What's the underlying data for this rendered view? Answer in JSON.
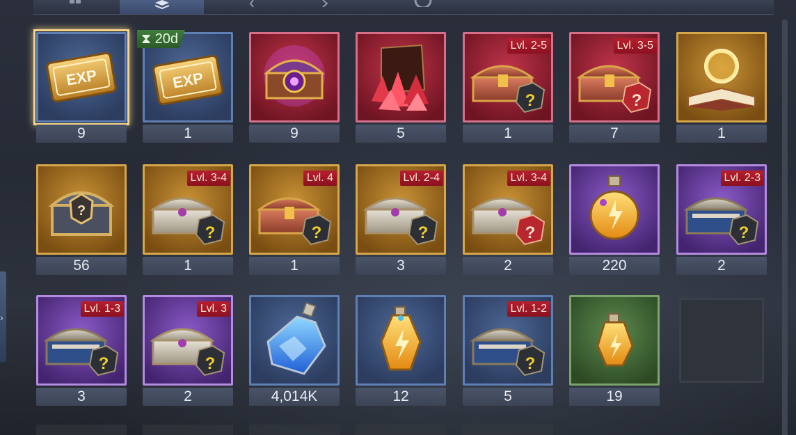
{
  "inventory": {
    "timer": "20d",
    "rows": [
      [
        {
          "icon": "exp-ticket-icon",
          "rarity": "blue",
          "count": "9",
          "selected": true
        },
        {
          "icon": "exp-ticket-icon",
          "rarity": "blue",
          "count": "1",
          "timer": true
        },
        {
          "icon": "magic-chest-icon",
          "rarity": "red",
          "count": "9"
        },
        {
          "icon": "red-crystal-icon",
          "rarity": "red",
          "count": "5"
        },
        {
          "icon": "red-chest-icon",
          "rarity": "red",
          "count": "1",
          "level": "Lvl. 2-5"
        },
        {
          "icon": "red-chest-icon",
          "rarity": "red",
          "count": "7",
          "level": "Lvl. 3-5"
        },
        {
          "icon": "spell-book-icon",
          "rarity": "gold",
          "count": "1"
        }
      ],
      [
        {
          "icon": "mystery-chest-icon",
          "rarity": "gold",
          "count": "56"
        },
        {
          "icon": "silver-chest-icon",
          "rarity": "gold",
          "count": "1",
          "level": "Lvl. 3-4"
        },
        {
          "icon": "red-chest-icon",
          "rarity": "gold",
          "count": "1",
          "level": "Lvl. 4"
        },
        {
          "icon": "silver-chest-icon",
          "rarity": "gold",
          "count": "3",
          "level": "Lvl. 2-4"
        },
        {
          "icon": "silver-chest-icon",
          "rarity": "gold",
          "count": "2",
          "level": "Lvl. 3-4"
        },
        {
          "icon": "gold-potion-icon",
          "rarity": "purple",
          "count": "220"
        },
        {
          "icon": "blue-chest-icon",
          "rarity": "purple",
          "count": "2",
          "level": "Lvl. 2-3"
        }
      ],
      [
        {
          "icon": "blue-chest-icon",
          "rarity": "purple",
          "count": "3",
          "level": "Lvl. 1-3"
        },
        {
          "icon": "silver-chest-icon",
          "rarity": "purple",
          "count": "2",
          "level": "Lvl. 3"
        },
        {
          "icon": "blue-potion-icon",
          "rarity": "blue",
          "count": "4,014K"
        },
        {
          "icon": "gold-potion-icon",
          "rarity": "blue",
          "count": "12"
        },
        {
          "icon": "blue-chest-icon",
          "rarity": "blue",
          "count": "5",
          "level": "Lvl. 1-2"
        },
        {
          "icon": "gold-potion-icon",
          "rarity": "green",
          "count": "19"
        },
        {
          "icon": "empty-slot",
          "rarity": "empty",
          "count": ""
        }
      ]
    ]
  }
}
